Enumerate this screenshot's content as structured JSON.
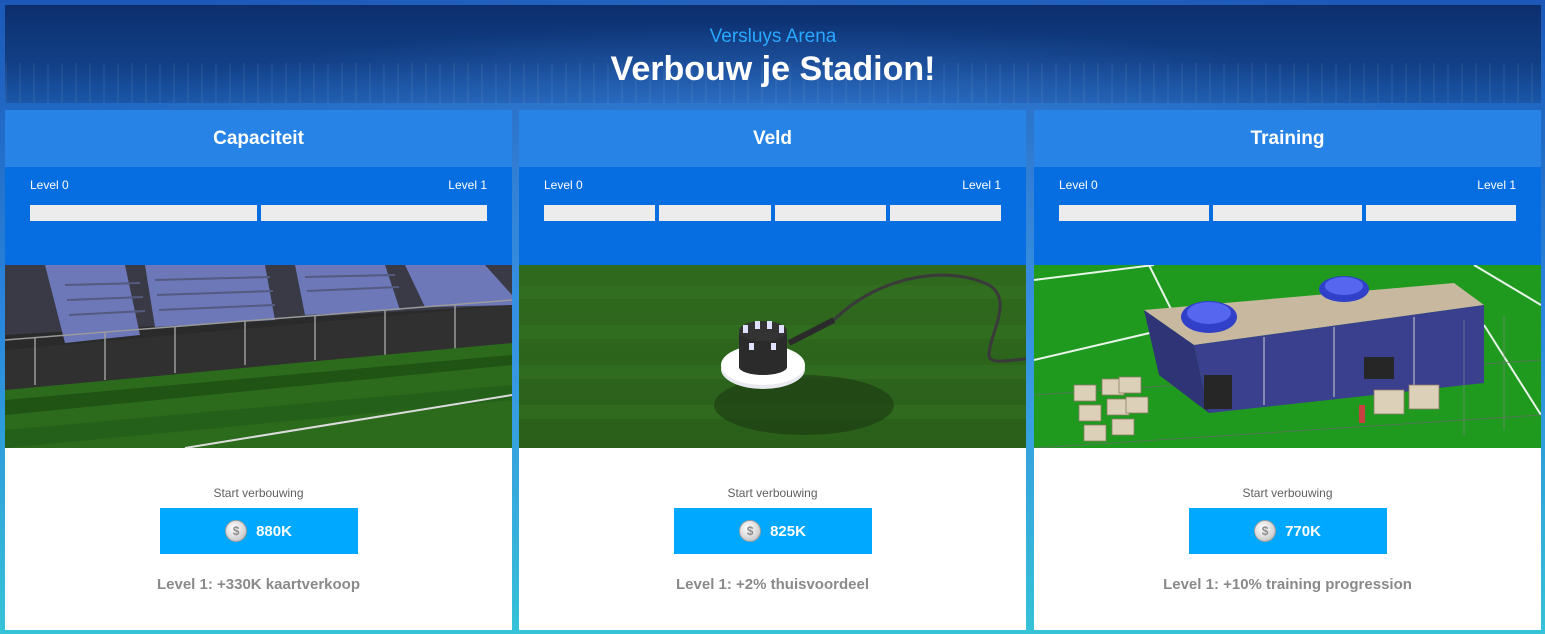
{
  "header": {
    "subtitle": "Versluys Arena",
    "title": "Verbouw je Stadion!"
  },
  "cards": [
    {
      "title": "Capaciteit",
      "level_from": "Level 0",
      "level_to": "Level 1",
      "segments": 2,
      "start_label": "Start verbouwing",
      "cost": "880K",
      "bonus": "Level 1: +330K kaartverkoop"
    },
    {
      "title": "Veld",
      "level_from": "Level 0",
      "level_to": "Level 1",
      "segments": 4,
      "start_label": "Start verbouwing",
      "cost": "825K",
      "bonus": "Level 1: +2% thuisvoordeel"
    },
    {
      "title": "Training",
      "level_from": "Level 0",
      "level_to": "Level 1",
      "segments": 3,
      "start_label": "Start verbouwing",
      "cost": "770K",
      "bonus": "Level 1: +10% training progression"
    }
  ],
  "icons": {
    "coin": "coin-icon",
    "coin_glyph": "$"
  },
  "colors": {
    "card_header": "#2784e6",
    "level_panel": "#066ee0",
    "button": "#00a8ff",
    "subtitle": "#29a8ff"
  }
}
